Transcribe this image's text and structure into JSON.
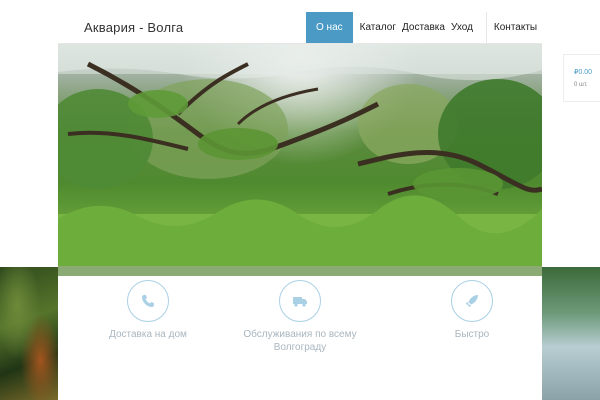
{
  "site": {
    "logo": "Аквария - Волга"
  },
  "nav": {
    "items": [
      {
        "label": "О нас",
        "active": true
      },
      {
        "label": "Каталог"
      },
      {
        "label": "Доставка"
      },
      {
        "label": "Уход"
      },
      {
        "label": "Контакты"
      }
    ]
  },
  "features": [
    {
      "icon": "phone-icon",
      "text": "Доставка на дом"
    },
    {
      "icon": "truck-icon",
      "text": "Обслуживания по всему Волгограду"
    },
    {
      "icon": "rocket-icon",
      "text": "Быстро"
    }
  ],
  "cart": {
    "total": "₽0.00",
    "count": "0 шт."
  },
  "colors": {
    "accent": "#4a9ac5",
    "feature_text": "#a9b6bf",
    "icon_outline": "#aad0e6"
  }
}
